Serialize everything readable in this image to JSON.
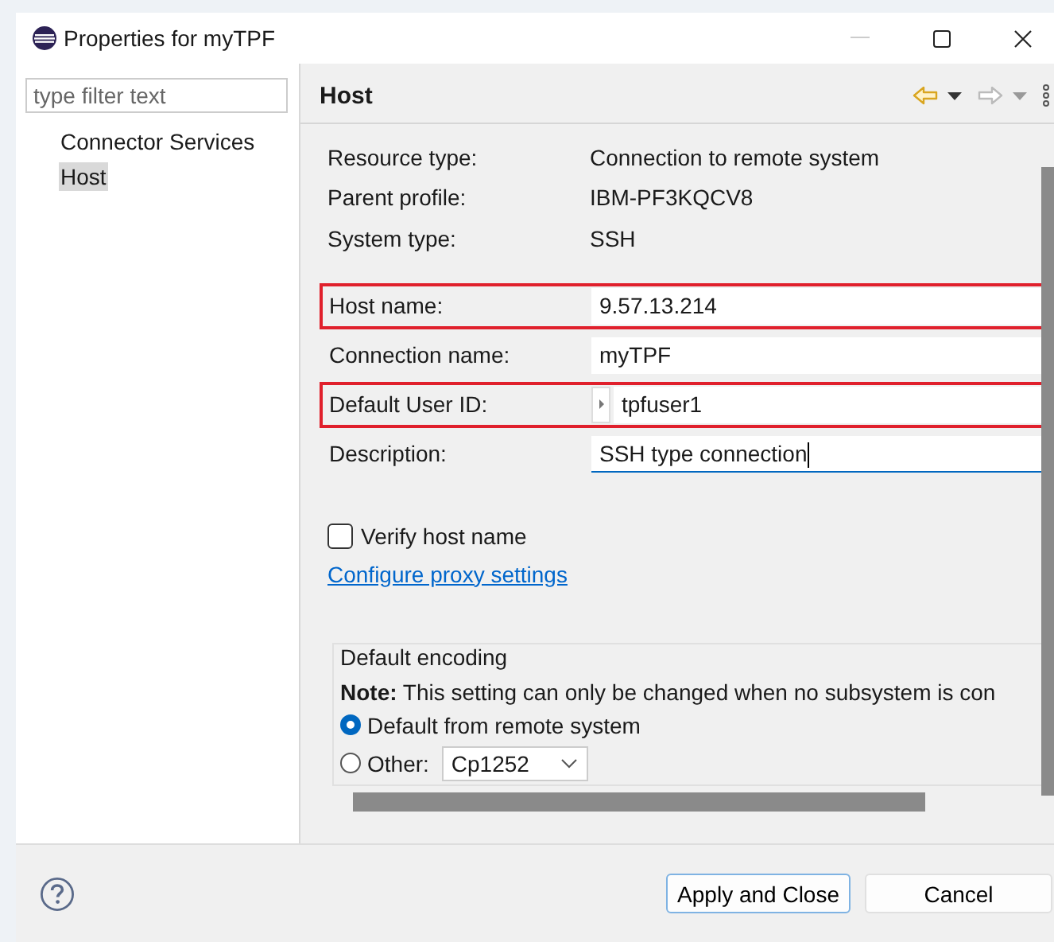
{
  "window": {
    "title": "Properties for myTPF"
  },
  "sidebar": {
    "filter": {
      "placeholder": "type filter text"
    },
    "items": [
      {
        "label": "Connector Services",
        "selected": false
      },
      {
        "label": "Host",
        "selected": true
      }
    ]
  },
  "page": {
    "title": "Host",
    "info": [
      {
        "label": "Resource type:",
        "value": "Connection to remote system"
      },
      {
        "label": "Parent profile:",
        "value": "IBM-PF3KQCV8"
      },
      {
        "label": "System type:",
        "value": "SSH"
      }
    ],
    "fields": [
      {
        "label": "Host name:",
        "value": "9.57.13.214",
        "highlighted": true,
        "kind": "text"
      },
      {
        "label": "Connection name:",
        "value": "myTPF",
        "highlighted": false,
        "kind": "text"
      },
      {
        "label": "Default User ID:",
        "value": "tpfuser1",
        "highlighted": true,
        "kind": "inherit"
      },
      {
        "label": "Description:",
        "value": "SSH type connection",
        "highlighted": false,
        "kind": "focused"
      }
    ],
    "verify_host_name": {
      "label": "Verify host name",
      "checked": false
    },
    "proxy_link": "Configure proxy settings",
    "encoding": {
      "title": "Default encoding",
      "note": "**Note:** This setting can only be changed when no subsystem is con",
      "options": [
        {
          "label": "Default from remote system",
          "selected": true
        },
        {
          "label": "Other:",
          "selected": false
        }
      ],
      "other_value": "Cp1252"
    }
  },
  "buttons": [
    {
      "label": "Apply and Close",
      "default": true
    },
    {
      "label": "Cancel",
      "default": false
    }
  ]
}
